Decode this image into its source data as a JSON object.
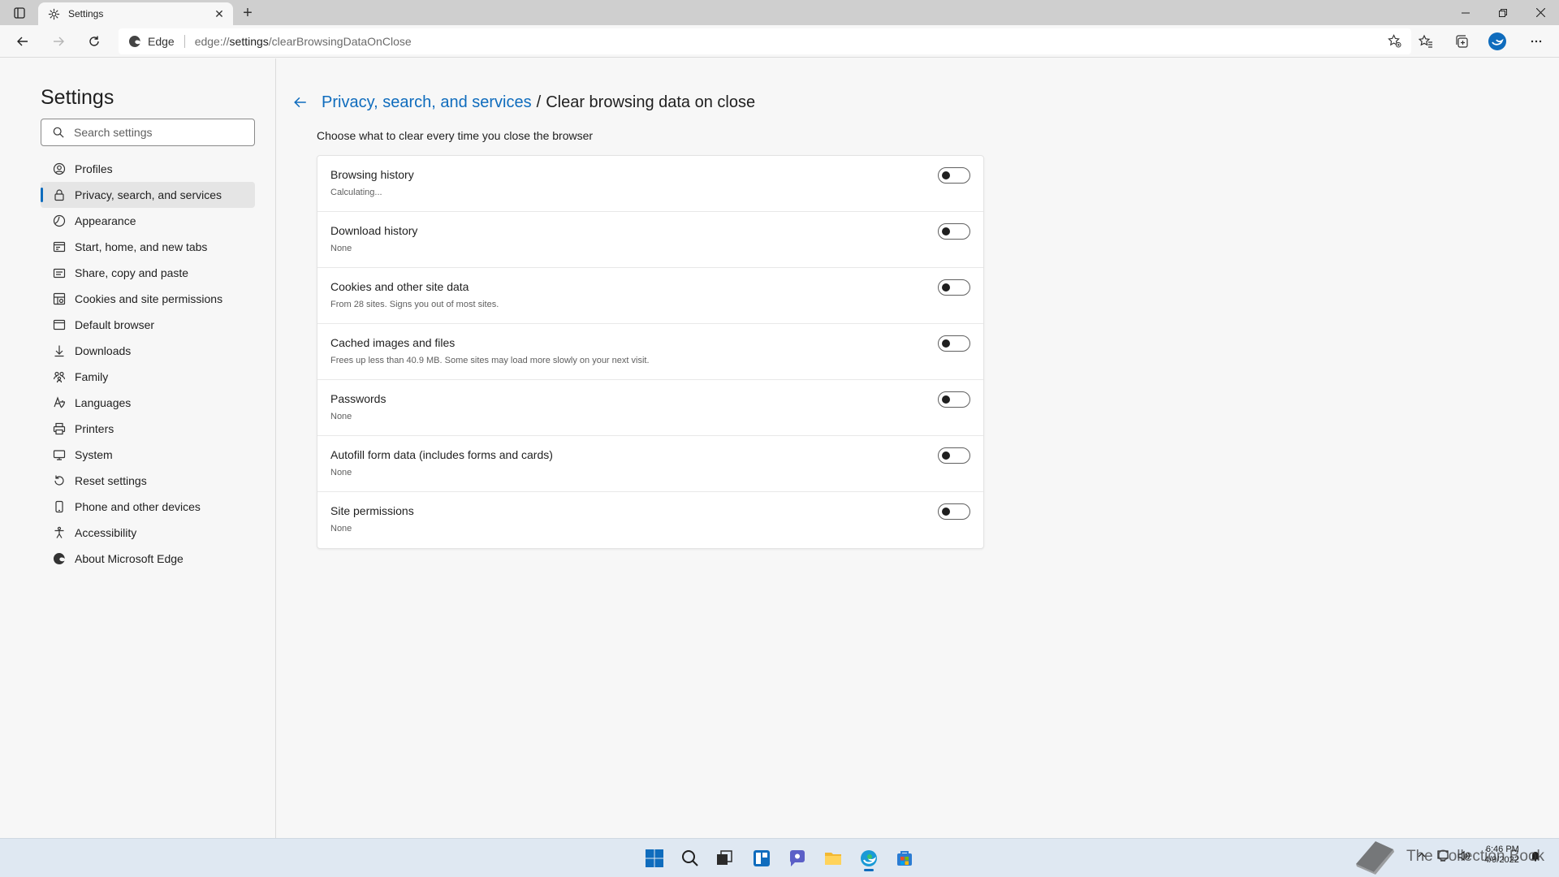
{
  "browser": {
    "tab_title": "Settings",
    "new_tab_symbol": "+",
    "close_symbol": "✕",
    "address": {
      "site_label": "Edge",
      "url_scheme": "edge://",
      "url_host": "settings",
      "url_path": "/clearBrowsingDataOnClose"
    }
  },
  "sidebar": {
    "title": "Settings",
    "search_placeholder": "Search settings",
    "items": [
      {
        "label": "Profiles",
        "icon": "profile-icon"
      },
      {
        "label": "Privacy, search, and services",
        "icon": "lock-icon",
        "active": true
      },
      {
        "label": "Appearance",
        "icon": "appearance-icon"
      },
      {
        "label": "Start, home, and new tabs",
        "icon": "start-tabs-icon"
      },
      {
        "label": "Share, copy and paste",
        "icon": "share-icon"
      },
      {
        "label": "Cookies and site permissions",
        "icon": "cookies-icon"
      },
      {
        "label": "Default browser",
        "icon": "browser-icon"
      },
      {
        "label": "Downloads",
        "icon": "download-icon"
      },
      {
        "label": "Family",
        "icon": "family-icon"
      },
      {
        "label": "Languages",
        "icon": "languages-icon"
      },
      {
        "label": "Printers",
        "icon": "printer-icon"
      },
      {
        "label": "System",
        "icon": "system-icon"
      },
      {
        "label": "Reset settings",
        "icon": "reset-icon"
      },
      {
        "label": "Phone and other devices",
        "icon": "phone-icon"
      },
      {
        "label": "Accessibility",
        "icon": "accessibility-icon"
      },
      {
        "label": "About Microsoft Edge",
        "icon": "edge-icon"
      }
    ]
  },
  "main": {
    "breadcrumb_link": "Privacy, search, and services",
    "breadcrumb_separator": "/",
    "page_title": "Clear browsing data on close",
    "subtitle": "Choose what to clear every time you close the browser",
    "options": [
      {
        "title": "Browsing history",
        "description": "Calculating...",
        "enabled": false
      },
      {
        "title": "Download history",
        "description": "None",
        "enabled": false
      },
      {
        "title": "Cookies and other site data",
        "description": "From 28 sites. Signs you out of most sites.",
        "enabled": false
      },
      {
        "title": "Cached images and files",
        "description": "Frees up less than 40.9 MB. Some sites may load more slowly on your next visit.",
        "enabled": false
      },
      {
        "title": "Passwords",
        "description": "None",
        "enabled": false
      },
      {
        "title": "Autofill form data (includes forms and cards)",
        "description": "None",
        "enabled": false
      },
      {
        "title": "Site permissions",
        "description": "None",
        "enabled": false
      }
    ]
  },
  "taskbar": {
    "watermark": "The Collection Book",
    "time": "6:46 PM",
    "date": "4/9/2022"
  },
  "colors": {
    "accent": "#0f6cbd",
    "page_bg": "#f7f7f7",
    "tab_strip": "#cfcfcf",
    "taskbar": "#dfe8f2"
  }
}
